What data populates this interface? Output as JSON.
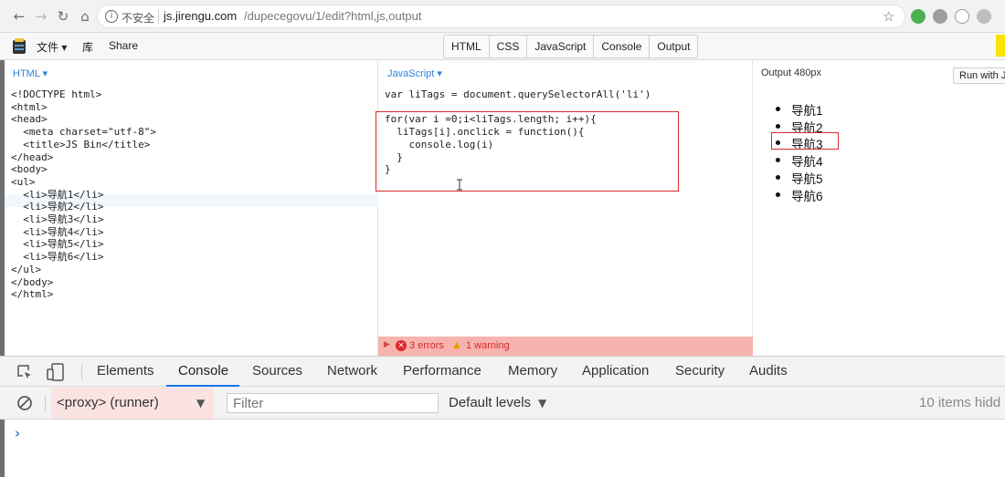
{
  "browser": {
    "insecure_label": "不安全",
    "url_domain": "js.jirengu.com",
    "url_path": "/dupecegovu/1/edit?html,js,output"
  },
  "jsbin": {
    "menu": [
      "文件",
      "库",
      "Share"
    ],
    "menu_file_caret": "▾",
    "panel_tabs": [
      "HTML",
      "CSS",
      "JavaScript",
      "Console",
      "Output"
    ],
    "html_panel_label": "HTML ▾",
    "js_panel_label": "JavaScript ▾",
    "output_panel_label": "Output 480px",
    "run_button_label": "Run with J"
  },
  "html_code": [
    "<!DOCTYPE html>",
    "<html>",
    "<head>",
    "  <meta charset=\"utf-8\">",
    "  <title>JS Bin</title>",
    "</head>",
    "<body>",
    "<ul>",
    "  <li>导航1</li>",
    "  <li>导航2</li>",
    "  <li>导航3</li>",
    "  <li>导航4</li>",
    "  <li>导航5</li>",
    "  <li>导航6</li>",
    "</ul>",
    "</body>",
    "</html>"
  ],
  "js_code": [
    "var liTags = document.querySelectorAll('li')",
    "",
    "for(var i =0;i<liTags.length; i++){",
    "  liTags[i].onclick = function(){",
    "    console.log(i)",
    "  }",
    "}"
  ],
  "errors": {
    "errors_text": "3 errors",
    "warning_text": "1 warning"
  },
  "output_items": [
    "导航1",
    "导航2",
    "导航3",
    "导航4",
    "导航5",
    "导航6"
  ],
  "devtools": {
    "tabs": [
      "Elements",
      "Console",
      "Sources",
      "Network",
      "Performance",
      "Memory",
      "Application",
      "Security",
      "Audits"
    ],
    "active_tab": "Console",
    "context": "<proxy> (runner)",
    "filter_placeholder": "Filter",
    "levels": "Default levels",
    "hidden_count": "10 items hidd",
    "prompt_symbol": "›"
  },
  "colors": {
    "accent_blue": "#1a73e8",
    "error_red": "#d9282f",
    "jsbin_yellow": "#fce300"
  }
}
